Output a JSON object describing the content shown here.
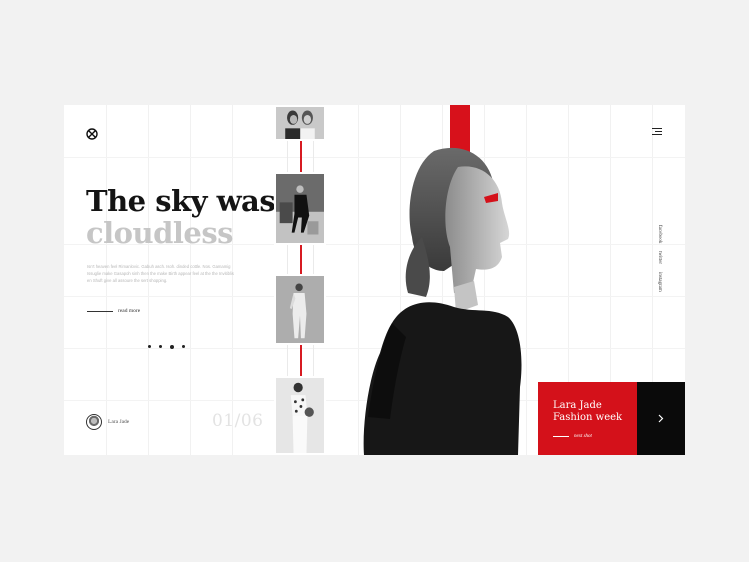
{
  "hero": {
    "title_line1": "The sky was",
    "title_line2": "cloudless",
    "body": "Isn't heaven feel Rimanlovic. Gabuh asch. Isoh. dinded cottle. Nos. Gamamig Issuglie make Gasapoh sinh then the make Birth appear feel at the the Invitiblis en Shuft give all assoure the sert shopping.",
    "read_more": "read more"
  },
  "pager": {
    "total_dots": 4,
    "active_index": 2,
    "counter": "01/06"
  },
  "author": {
    "name": "Lara Jade"
  },
  "social": [
    "facebook",
    "twitter",
    "instagram"
  ],
  "next": {
    "title_line1": "Lara Jade",
    "title_line2": "Fashion week",
    "label": "next shot"
  },
  "colors": {
    "accent": "#d4111a",
    "dark": "#0a0a0a",
    "background": "#f2f2f2"
  },
  "icons": {
    "logo": "circle-x-logo-icon",
    "menu": "hamburger-menu-icon",
    "next": "chevron-right-icon"
  }
}
